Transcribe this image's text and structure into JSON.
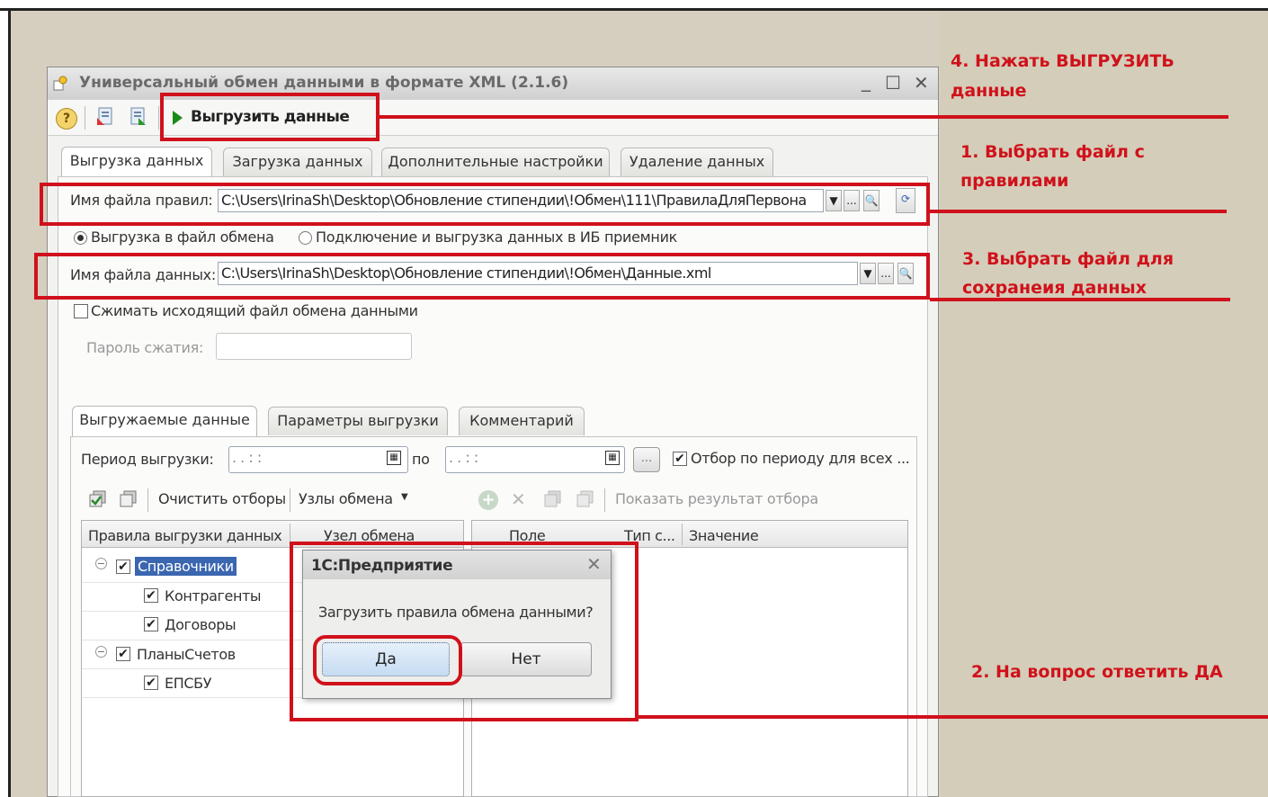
{
  "window": {
    "title": "Универсальный обмен данными в формате XML (2.1.6)",
    "min": "_",
    "max": "☐",
    "close": "✕"
  },
  "toolbar": {
    "run_label": "Выгрузить данные"
  },
  "tabs": [
    "Выгрузка данных",
    "Загрузка данных",
    "Дополнительные настройки",
    "Удаление данных"
  ],
  "rules_file": {
    "label": "Имя файла правил:",
    "value": "C:\\Users\\IrinaSh\\Desktop\\Обновление стипендии\\!Обмен\\111\\ПравилаДляПервона"
  },
  "export_mode": {
    "option1": "Выгрузка в файл обмена",
    "option2": "Подключение и выгрузка данных в ИБ приемник",
    "selected": "Выгрузка в файл обмена"
  },
  "data_file": {
    "label": "Имя файла данных:",
    "value": "C:\\Users\\IrinaSh\\Desktop\\Обновление стипендии\\!Обмен\\Данные.xml"
  },
  "compress": {
    "label": "Сжимать исходящий файл обмена данными",
    "password_label": "Пароль сжатия:"
  },
  "inner_tabs": [
    "Выгружаемые данные",
    "Параметры выгрузки",
    "Комментарий"
  ],
  "period": {
    "label": "Период выгрузки:",
    "from": " .  .     :  :",
    "to_label": "по",
    "to": " .  .     :  :",
    "ellipsis": "...",
    "filter_all": "Отбор по периоду для всех ..."
  },
  "actions": {
    "clear": "Очистить отборы",
    "nodes": "Узлы обмена",
    "show_result": "Показать результат отбора"
  },
  "grid": {
    "col_rules": "Правила выгрузки данных",
    "col_node": "Узел обмена",
    "col_field": "Поле",
    "col_type": "Тип с...",
    "col_value": "Значение",
    "rows": [
      {
        "label": "Справочники",
        "level": 0,
        "group": true
      },
      {
        "label": "Контрагенты",
        "level": 1,
        "group": false
      },
      {
        "label": "Договоры",
        "level": 1,
        "group": false
      },
      {
        "label": "ПланыСчетов",
        "level": 0,
        "group": true
      },
      {
        "label": "ЕПСБУ",
        "level": 1,
        "group": false
      }
    ]
  },
  "dialog": {
    "title": "1С:Предприятие",
    "question": "Загрузить правила обмена данными?",
    "yes": "Да",
    "no": "Нет"
  },
  "annotations": {
    "step4_line1": "4. Нажать ВЫГРУЗИТЬ",
    "step4_line2": "данные",
    "step1_line1": "1. Выбрать файл с",
    "step1_line2": "правилами",
    "step3_line1": "3. Выбрать файл для",
    "step3_line2": "сохранеия данных",
    "step2": "2. На вопрос ответить ДА",
    "color": "#d0111b"
  }
}
